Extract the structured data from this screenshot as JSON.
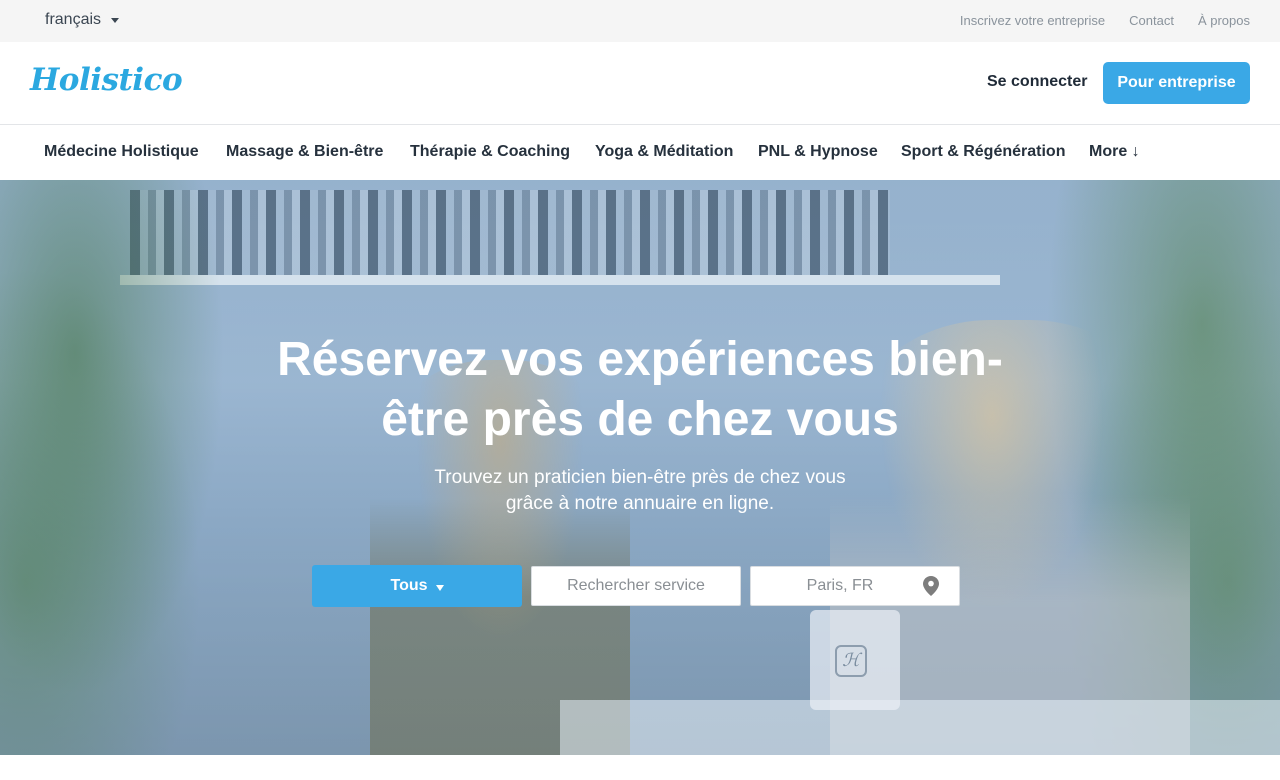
{
  "topbar": {
    "language": "français",
    "links": [
      "Inscrivez votre entreprise",
      "Contact",
      "À propos"
    ]
  },
  "header": {
    "logo": "Holistico",
    "signin_label": "Se connecter",
    "business_button": "Pour entreprise"
  },
  "categories": [
    "Médecine Holistique",
    "Massage & Bien-être",
    "Thérapie & Coaching",
    "Yoga & Méditation",
    "PNL & Hypnose",
    "Sport & Régénération",
    "More ↓"
  ],
  "hero": {
    "title": "Réservez vos expériences bien-être près de chez vous",
    "subtitle_line1": "Trouvez un praticien bien-être près de chez vous",
    "subtitle_line2": "grâce à notre annuaire en ligne."
  },
  "search": {
    "category_select": "Tous",
    "service_placeholder": "Rechercher service",
    "location_placeholder": "Paris, FR"
  },
  "colors": {
    "brand": "#2ba8e0",
    "button": "#3aa8e6"
  }
}
